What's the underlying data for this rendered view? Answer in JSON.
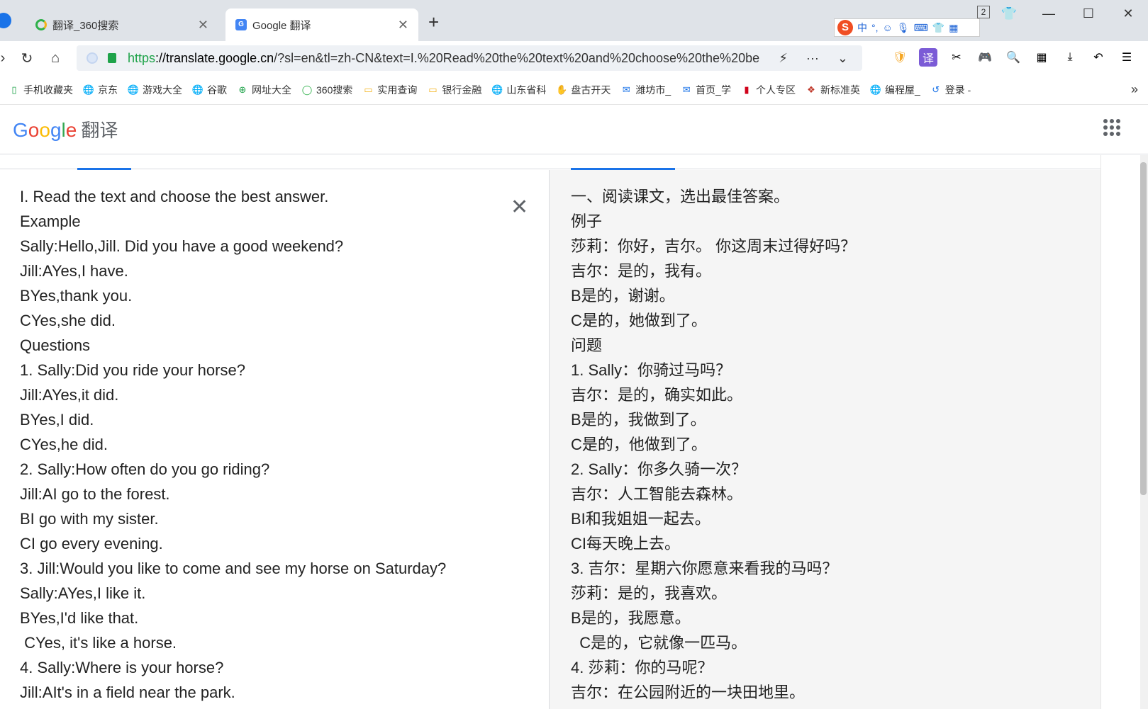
{
  "tabs": [
    {
      "title": "翻译_360搜索",
      "icon": "360-search-icon"
    },
    {
      "title": "Google 翻译",
      "icon": "google-translate-icon"
    }
  ],
  "tab_count": "2",
  "ime": {
    "logo": "S",
    "label": "中"
  },
  "address": {
    "scheme": "https",
    "host": "://translate.google.cn",
    "path": "/?sl=en&tl=zh-CN&text=I.%20Read%20the%20text%20and%20choose%20the%20be"
  },
  "bookmarks": [
    "手机收藏夹",
    "京东",
    "游戏大全",
    "谷歌",
    "网址大全",
    "360搜索",
    "实用查询",
    "银行金融",
    "山东省科",
    "盘古开天",
    "潍坊市_",
    "首页_学",
    "个人专区",
    "新标准英",
    "编程屋_",
    "登录 -"
  ],
  "header": {
    "logo_letters": [
      "G",
      "o",
      "o",
      "g",
      "l",
      "e"
    ],
    "product": "翻译"
  },
  "source_lines": [
    "I. Read the text and choose the best answer.",
    "Example",
    "Sally:Hello,Jill. Did you have a good weekend?",
    "Jill:AYes,I have.",
    "BYes,thank you.",
    "CYes,she did.",
    "Questions",
    "1. Sally:Did you ride your horse?",
    "Jill:AYes,it did.",
    "BYes,I did.",
    "CYes,he did.",
    "2. Sally:How often do you go riding?",
    "Jill:AI go to the forest.",
    "BI go with my sister.",
    "CI go every evening.",
    "3. Jill:Would you like to come and see my horse on Saturday?",
    "Sally:AYes,I like it.",
    "BYes,I'd like that.",
    " CYes, it's like a horse.",
    "4. Sally:Where is your horse?",
    "Jill:AIt's in a field near the park."
  ],
  "target_lines": [
    "一、阅读课文，选出最佳答案。",
    "例子",
    "莎莉：你好，吉尔。 你这周末过得好吗？",
    "吉尔：是的，我有。",
    "B是的，谢谢。",
    "C是的，她做到了。",
    "问题",
    "1. Sally：你骑过马吗？",
    "吉尔：是的，确实如此。",
    "B是的，我做到了。",
    "C是的，他做到了。",
    "2. Sally：你多久骑一次？",
    "吉尔：人工智能去森林。",
    "BI和我姐姐一起去。",
    "CI每天晚上去。",
    "3. 吉尔：星期六你愿意来看我的马吗？",
    "莎莉：是的，我喜欢。",
    "B是的，我愿意。",
    "  C是的，它就像一匹马。",
    "4. 莎莉：你的马呢？",
    "吉尔：在公园附近的一块田地里。"
  ]
}
